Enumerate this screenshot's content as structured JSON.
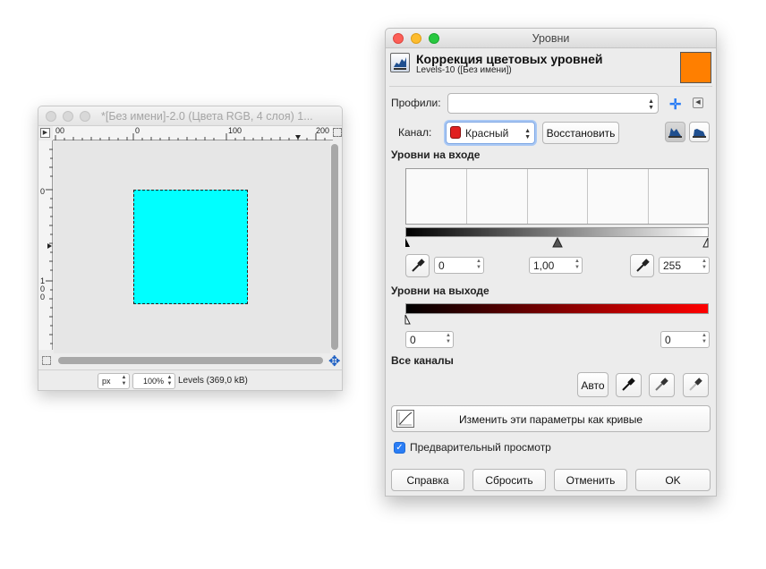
{
  "image_window": {
    "title": "*[Без имени]-2.0 (Цвета RGB, 4 слоя) 1...",
    "ruler_h_labels": [
      "00",
      "0",
      "100",
      "200"
    ],
    "ruler_v_labels": [
      "0",
      "1",
      "0",
      "0"
    ],
    "canvas_fill_color": "#00ffff",
    "unit": "px",
    "zoom": "100%",
    "status": "Levels (369,0 kB)"
  },
  "levels_dialog": {
    "window_title": "Уровни",
    "header_title": "Коррекция цветовых уровней",
    "header_subtitle": "Levels-10 ([Без имени])",
    "color_swatch": "#ff7f00",
    "presets_label": "Профили:",
    "presets_value": "",
    "channel_label": "Канал:",
    "channel_value": "Красный",
    "reset_channel_label": "Восстановить",
    "input_levels_label": "Уровни на входе",
    "input_low": "0",
    "input_gamma": "1,00",
    "input_high": "255",
    "output_levels_label": "Уровни на выходе",
    "output_low": "0",
    "output_high": "0",
    "all_channels_label": "Все каналы",
    "auto_label": "Авто",
    "edit_as_curves_label": "Изменить эти параметры как кривые",
    "preview_label": "Предварительный просмотр",
    "preview_checked": true,
    "help_label": "Справка",
    "reset_label": "Сбросить",
    "cancel_label": "Отменить",
    "ok_label": "OK"
  }
}
